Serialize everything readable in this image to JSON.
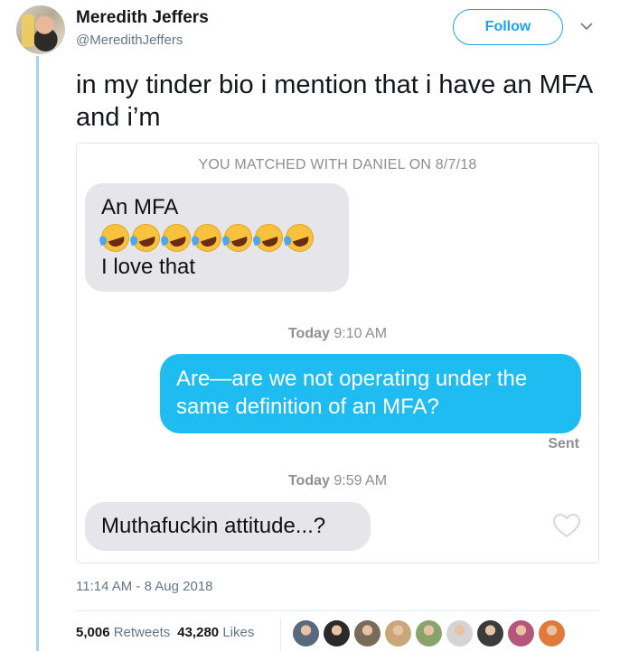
{
  "user": {
    "display_name": "Meredith Jeffers",
    "handle": "@MeredithJeffers"
  },
  "header": {
    "follow_label": "Follow"
  },
  "tweet": {
    "text": "in my tinder bio i mention that i have an MFA and i’m",
    "timestamp": "11:14 AM - 8 Aug 2018"
  },
  "media": {
    "match_header": "YOU MATCHED WITH DANIEL ON 8/7/18",
    "msg1_line1": "An MFA",
    "msg1_line2": "I love that",
    "emoji_count": 7,
    "time1_day": "Today",
    "time1_time": "9:10 AM",
    "msg2": "Are—are we not operating under the same definition of an MFA?",
    "sent_label": "Sent",
    "time2_day": "Today",
    "time2_time": "9:59 AM",
    "msg3": "Muthafuckin attitude...?"
  },
  "stats": {
    "retweets_count": "5,006",
    "retweets_label": "Retweets",
    "likes_count": "43,280",
    "likes_label": "Likes"
  },
  "colors": {
    "brand": "#1da1f2",
    "imessage_blue": "#1ebcf0",
    "bubble_gray": "#e5e5ea"
  },
  "likers": [
    "#5a6a7c",
    "#2a2a2a",
    "#7a6a5a",
    "#c9a77a",
    "#8aa36b",
    "#d4d4d4",
    "#3b3b3b",
    "#b5577a",
    "#e07a3b"
  ]
}
